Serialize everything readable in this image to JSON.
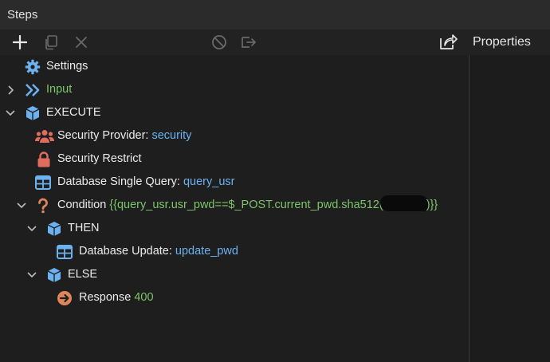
{
  "panel": {
    "title": "Steps"
  },
  "toolbar": {
    "add_icon": "plus-icon",
    "copy_icon": "copy-icon",
    "delete_icon": "x-icon",
    "disable_icon": "ban-icon",
    "move_icon": "move-out-icon",
    "export_icon": "share-icon",
    "properties_label": "Properties"
  },
  "steps": {
    "settings": {
      "label": "Settings",
      "icon": "gear-icon"
    },
    "input": {
      "label": "Input",
      "icon": "double-chevron-icon"
    },
    "execute": {
      "label": "EXECUTE",
      "icon": "cube-icon"
    },
    "security_provider": {
      "label": "Security Provider: ",
      "value": "security",
      "icon": "users-icon"
    },
    "security_restrict": {
      "label": "Security Restrict",
      "icon": "lock-icon"
    },
    "db_query": {
      "label": "Database Single Query: ",
      "value": "query_usr",
      "icon": "table-icon"
    },
    "condition": {
      "label": "Condition ",
      "code_start": "{{query_usr.usr_pwd==$_POST.current_pwd.sha512(",
      "code_end": ")}}",
      "icon": "question-icon"
    },
    "then": {
      "label": "THEN",
      "icon": "cube-icon"
    },
    "db_update": {
      "label": "Database Update: ",
      "value": "update_pwd",
      "icon": "table-icon"
    },
    "else": {
      "label": "ELSE",
      "icon": "cube-icon"
    },
    "response": {
      "label": "Response ",
      "value": "400",
      "icon": "arrow-right-circle-icon"
    }
  },
  "colors": {
    "accent_blue": "#6cb2f0",
    "code_green": "#7dc46a",
    "security_red": "#e06c5f",
    "condition_orange": "#e0875a"
  }
}
